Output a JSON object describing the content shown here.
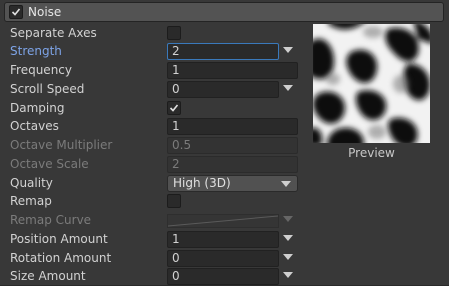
{
  "module": {
    "title": "Noise",
    "enabled": true
  },
  "properties": {
    "separate_axes": {
      "label": "Separate Axes",
      "checked": false
    },
    "strength": {
      "label": "Strength",
      "value": "2"
    },
    "frequency": {
      "label": "Frequency",
      "value": "1"
    },
    "scroll_speed": {
      "label": "Scroll Speed",
      "value": "0"
    },
    "damping": {
      "label": "Damping",
      "checked": true
    },
    "octaves": {
      "label": "Octaves",
      "value": "1"
    },
    "octave_multiplier": {
      "label": "Octave Multiplier",
      "value": "0.5"
    },
    "octave_scale": {
      "label": "Octave Scale",
      "value": "2"
    },
    "quality": {
      "label": "Quality",
      "value": "High (3D)"
    },
    "remap": {
      "label": "Remap",
      "checked": false
    },
    "remap_curve": {
      "label": "Remap Curve"
    },
    "position_amount": {
      "label": "Position Amount",
      "value": "1"
    },
    "rotation_amount": {
      "label": "Rotation Amount",
      "value": "0"
    },
    "size_amount": {
      "label": "Size Amount",
      "value": "0"
    }
  },
  "preview": {
    "label": "Preview"
  },
  "colors": {
    "background": "#383838",
    "field": "#2a2a2a",
    "highlight_label": "#7da3e6",
    "focus_border": "#3a79bb"
  }
}
